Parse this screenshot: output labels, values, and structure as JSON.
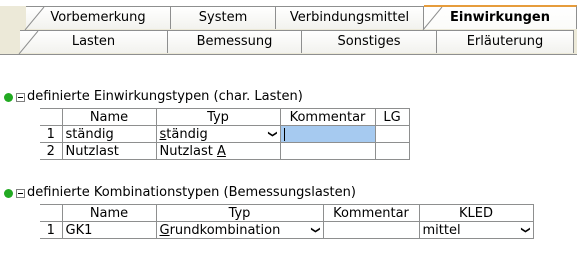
{
  "tabs_row1": [
    "Vorbemerkung",
    "System",
    "Verbindungsmittel",
    "Einwirkungen"
  ],
  "tabs_row2": [
    "Lasten",
    "Bemessung",
    "Sonstiges",
    "Erläuterung"
  ],
  "section1": {
    "title": "definierte Einwirkungstypen (char. Lasten)",
    "headers": [
      "Name",
      "Typ",
      "Kommentar",
      "LG"
    ],
    "rows": [
      {
        "idx": "1",
        "name": "ständig",
        "typ_pre": "",
        "typ_ul": "s",
        "typ_post": "tändig",
        "kommentar": "",
        "lg": ""
      },
      {
        "idx": "2",
        "name": "Nutzlast",
        "typ_pre": "Nutzlast ",
        "typ_ul": "A",
        "typ_post": "",
        "kommentar": "",
        "lg": ""
      }
    ]
  },
  "section2": {
    "title": "definierte Kombinationstypen (Bemessungslasten)",
    "headers": [
      "Name",
      "Typ",
      "Kommentar",
      "KLED"
    ],
    "rows": [
      {
        "idx": "1",
        "name": "GK1",
        "typ_ul": "G",
        "typ_post": "rundkombination",
        "kommentar": "",
        "kled": "mittel"
      }
    ]
  },
  "icons": {
    "dropdown": "chevron-down-icon",
    "status": "green-dot-icon",
    "collapse": "collapse-minus-icon"
  },
  "colors": {
    "active_tab_accent": "#e69c3c",
    "status_dot": "#22aa22",
    "edit_selection": "#a6caf0"
  }
}
